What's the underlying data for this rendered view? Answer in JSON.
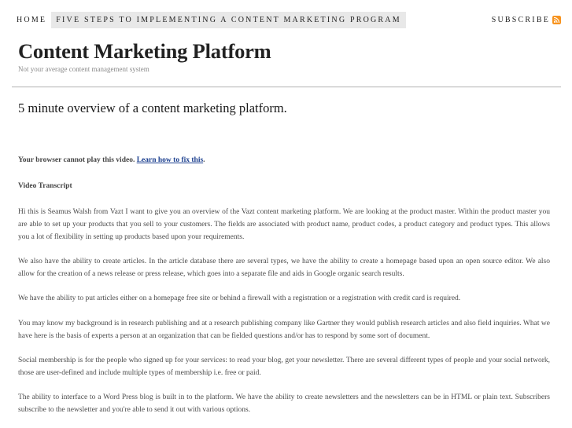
{
  "nav": {
    "home": "HOME",
    "page": "FIVE STEPS TO IMPLEMENTING A CONTENT MARKETING PROGRAM",
    "subscribe": "SUBSCRIBE",
    "subscribe_icon": "rss-feed-icon"
  },
  "header": {
    "title": "Content Marketing Platform",
    "tagline": "Not your average content management system"
  },
  "post": {
    "title": "5 minute overview of a content marketing platform.",
    "video_notice": "Your browser cannot play this video.",
    "video_link": "Learn how to fix this",
    "video_notice_end": ".",
    "transcript_heading": "Video Transcript",
    "paragraphs": [
      "Hi this is Seamus Walsh from Vazt I want to give you an overview of the Vazt content marketing platform. We are looking at the product master. Within the product master you are able to set up your products that you sell to your customers. The fields are associated with product name, product codes, a product category and product types. This allows you a lot of flexibility in setting up products based upon your requirements.",
      "We also have the ability to create articles. In the article database there are several types, we have the ability to create a homepage based upon an open source editor. We also allow for the creation of a news release or press release, which goes into a separate file and aids in Google organic search results.",
      "We have the ability to put articles either on a homepage free site or behind a firewall with a registration or a registration with credit card is required.",
      "You may know my background is in research publishing and at a research publishing company like Gartner they would publish research articles and also field inquiries. What we have here is the basis of experts a person at an organization that can be fielded questions and/or has to respond by some sort of document.",
      "Social membership is for the people who signed up for your services: to read your blog, get your newsletter. There are several different types of people and your social network, those are user-defined and include multiple types of membership i.e. free or paid.",
      "The ability to interface to a Word Press blog is built in to the platform. We have the ability to create newsletters and the newsletters can be in HTML or plain text. Subscribers subscribe to the newsletter and you're able to send it out with various options."
    ]
  },
  "colors": {
    "accent_link": "#1b3f8f",
    "nav_active_bg": "#e8e8e8",
    "rss_orange": "#f7931e"
  }
}
